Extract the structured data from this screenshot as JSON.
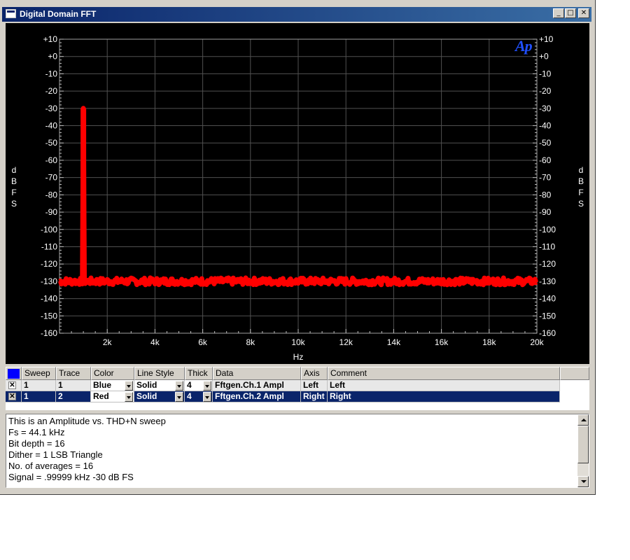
{
  "window": {
    "title": "Digital Domain FFT",
    "controls": {
      "minimize": "_",
      "maximize": "□",
      "close": "✕"
    }
  },
  "plot": {
    "logo": "Ap",
    "background_color": "#000000",
    "grid_color": "#505050",
    "trace_color": "#ff0000"
  },
  "chart_data": {
    "type": "line",
    "xlabel": "Hz",
    "ylabel": "dBFS",
    "ylabel_right": "dBFS",
    "xlim": [
      0,
      20000
    ],
    "ylim": [
      -160,
      10
    ],
    "x_ticks": [
      "2k",
      "4k",
      "6k",
      "8k",
      "10k",
      "12k",
      "14k",
      "16k",
      "18k",
      "20k"
    ],
    "y_ticks": [
      "+10",
      "+0",
      "-10",
      "-20",
      "-30",
      "-40",
      "-50",
      "-60",
      "-70",
      "-80",
      "-90",
      "-100",
      "-110",
      "-120",
      "-130",
      "-140",
      "-150",
      "-160"
    ],
    "grid": true,
    "series": [
      {
        "name": "Fftgen.Ch.2 Ampl",
        "color": "#ff0000",
        "noise_floor_db": -130,
        "peak": {
          "x": 1000,
          "y": -30
        },
        "x": [
          0,
          1000,
          2000,
          4000,
          6000,
          8000,
          10000,
          12000,
          14000,
          16000,
          18000,
          20000
        ],
        "y": [
          -130,
          -30,
          -130,
          -130,
          -131,
          -130,
          -130,
          -130,
          -130,
          -130,
          -130,
          -130
        ]
      }
    ]
  },
  "table": {
    "headers": [
      "Sweep",
      "Trace",
      "Color",
      "Line Style",
      "Thick",
      "Data",
      "Axis",
      "Comment"
    ],
    "rows": [
      {
        "checked": "✕",
        "sweep": "1",
        "trace": "1",
        "color": "Blue",
        "line_style": "Solid",
        "thick": "4",
        "data": "Fftgen.Ch.1 Ampl",
        "axis": "Left",
        "comment": "Left"
      },
      {
        "checked": "✕",
        "sweep": "1",
        "trace": "2",
        "color": "Red",
        "line_style": "Solid",
        "thick": "4",
        "data": "Fftgen.Ch.2 Ampl",
        "axis": "Right",
        "comment": "Right"
      }
    ],
    "selected_row": 1,
    "header_swatch_color": "#0000ff",
    "selection_color": "#0a246a"
  },
  "notes": {
    "lines": [
      "This is an Amplitude vs. THD+N sweep",
      "Fs = 44.1 kHz",
      "Bit depth = 16",
      "Dither = 1 LSB Triangle",
      "No. of averages = 16",
      "Signal = .99999 kHz -30 dB FS"
    ]
  }
}
